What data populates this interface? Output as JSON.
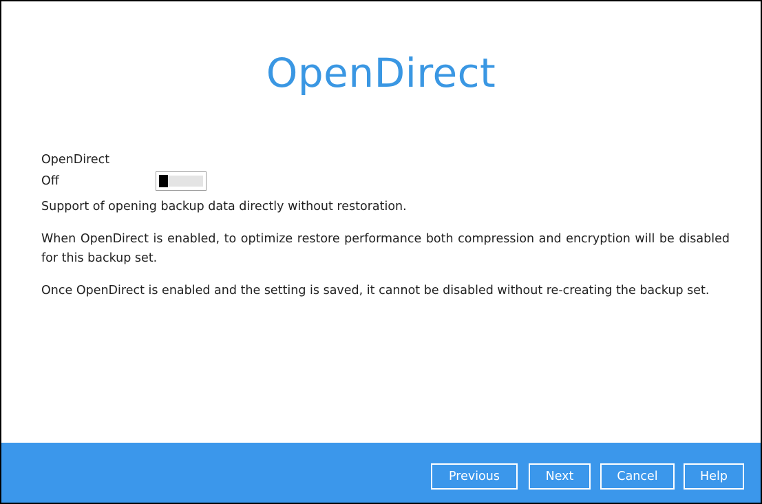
{
  "page": {
    "title": "OpenDirect"
  },
  "settings": {
    "section_label": "OpenDirect",
    "toggle_state_label": "Off",
    "toggle_on": false,
    "description": "Support of opening backup data directly without restoration.",
    "note_1": "When OpenDirect is enabled, to optimize restore performance both compression and encryption will be disabled for this backup set.",
    "note_2": "Once OpenDirect is enabled and the setting is saved, it cannot be disabled without re-creating the backup set."
  },
  "footer": {
    "previous_label": "Previous",
    "next_label": "Next",
    "cancel_label": "Cancel",
    "help_label": "Help"
  },
  "colors": {
    "title": "#3a97e3",
    "footer_bg": "#3b97eb",
    "toggle_knob": "#000000"
  }
}
